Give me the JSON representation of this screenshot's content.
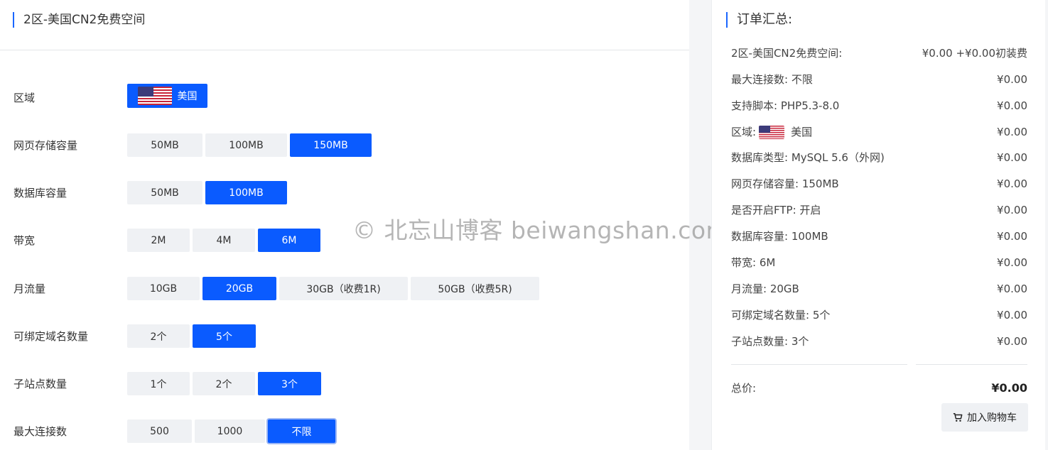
{
  "product": {
    "title": "2区-美国CN2免费空间"
  },
  "options": {
    "region": {
      "label": "区域",
      "choices": [
        "美国"
      ],
      "selected": 0,
      "flag_icon": "us-flag-icon"
    },
    "storage": {
      "label": "网页存储容量",
      "choices": [
        "50MB",
        "100MB",
        "150MB"
      ],
      "selected": 2
    },
    "db_size": {
      "label": "数据库容量",
      "choices": [
        "50MB",
        "100MB"
      ],
      "selected": 1
    },
    "bandwidth": {
      "label": "带宽",
      "choices": [
        "2M",
        "4M",
        "6M"
      ],
      "selected": 2
    },
    "traffic": {
      "label": "月流量",
      "choices": [
        "10GB",
        "20GB",
        "30GB（收费1R)",
        "50GB（收费5R)"
      ],
      "selected": 1
    },
    "domains": {
      "label": "可绑定域名数量",
      "choices": [
        "2个",
        "5个"
      ],
      "selected": 1
    },
    "subsites": {
      "label": "子站点数量",
      "choices": [
        "1个",
        "2个",
        "3个"
      ],
      "selected": 2
    },
    "connections": {
      "label": "最大连接数",
      "choices": [
        "500",
        "1000",
        "不限"
      ],
      "selected": 2
    }
  },
  "watermark": "© 北忘山博客 beiwangshan.com",
  "summary": {
    "title": "订单汇总:",
    "rows": [
      {
        "key": "2区-美国CN2免费空间:",
        "value": "¥0.00 +¥0.00初装费"
      },
      {
        "key": "最大连接数: 不限",
        "value": "¥0.00"
      },
      {
        "key": "支持脚本: PHP5.3-8.0",
        "value": "¥0.00"
      },
      {
        "key": "区域:",
        "key_suffix": "美国",
        "value": "¥0.00"
      },
      {
        "key": "数据库类型: MySQL 5.6（外网)",
        "value": "¥0.00"
      },
      {
        "key": "网页存储容量: 150MB",
        "value": "¥0.00"
      },
      {
        "key": "是否开启FTP: 开启",
        "value": "¥0.00"
      },
      {
        "key": "数据库容量: 100MB",
        "value": "¥0.00"
      },
      {
        "key": "带宽: 6M",
        "value": "¥0.00"
      },
      {
        "key": "月流量: 20GB",
        "value": "¥0.00"
      },
      {
        "key": "可绑定域名数量: 5个",
        "value": "¥0.00"
      },
      {
        "key": "子站点数量: 3个",
        "value": "¥0.00"
      }
    ],
    "total_label": "总价:",
    "total_value": "¥0.00",
    "cart_button": "加入购物车"
  },
  "colors": {
    "accent": "#0a5bff",
    "option_bg": "#eff1f4",
    "page_bg": "#f4f5f7"
  }
}
